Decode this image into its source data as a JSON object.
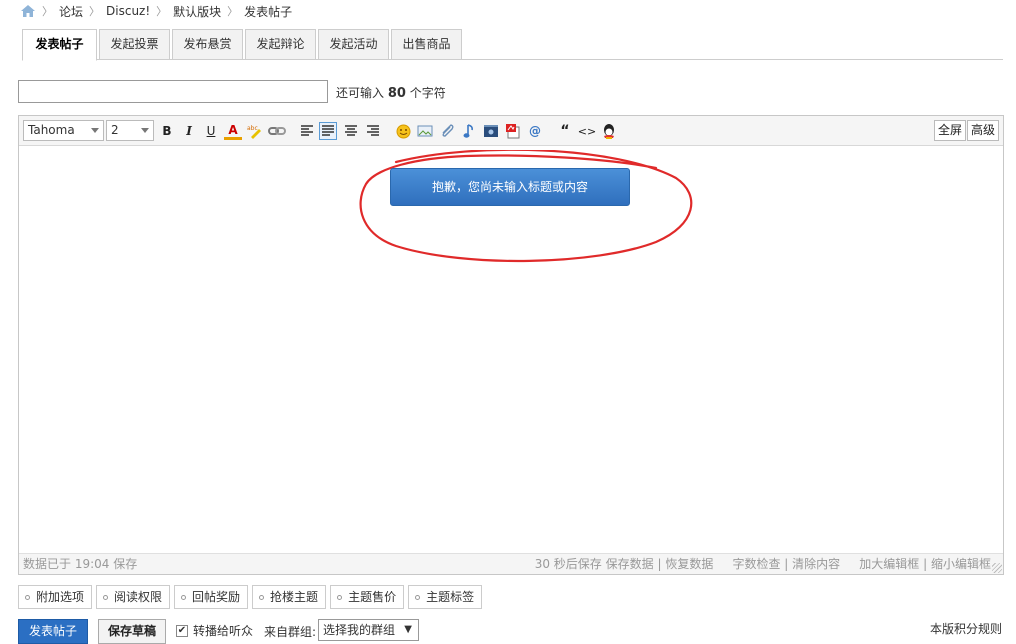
{
  "breadcrumb": {
    "items": [
      "论坛",
      "Discuz!",
      "默认版块",
      "发表帖子"
    ]
  },
  "tabs": [
    {
      "label": "发表帖子",
      "active": true
    },
    {
      "label": "发起投票"
    },
    {
      "label": "发布悬赏"
    },
    {
      "label": "发起辩论"
    },
    {
      "label": "发起活动"
    },
    {
      "label": "出售商品"
    }
  ],
  "subject": {
    "value": "",
    "remain_prefix": "还可输入",
    "remain_count": "80",
    "remain_suffix": "个字符"
  },
  "toolbar": {
    "font": "Tahoma",
    "size": "2",
    "bold": "B",
    "italic": "I",
    "underline": "U",
    "fontcolor": "A",
    "quote": "“",
    "code": "<>",
    "fullscreen": "全屏",
    "advanced": "高级"
  },
  "tip": {
    "message": "抱歉，您尚未输入标题或内容"
  },
  "editor_status": {
    "autosave": "数据已于 19:04 保存",
    "save_timer": "30 秒后保存",
    "save_data": "保存数据",
    "restore_data": "恢复数据",
    "word_check": "字数检查",
    "clear": "清除内容",
    "enlarge": "加大编辑框",
    "shrink": "缩小编辑框"
  },
  "options": [
    "附加选项",
    "阅读权限",
    "回帖奖励",
    "抢楼主题",
    "主题售价",
    "主题标签"
  ],
  "footer": {
    "submit": "发表帖子",
    "draft": "保存草稿",
    "relay": "转播给听众",
    "relay_checked": true,
    "checkmark": "✔",
    "group_label": "来自群组:",
    "group_select": "选择我的群组",
    "rules": "本版积分规则"
  },
  "colors": {
    "primary": "#2b6fc3",
    "tip_blue": "#3a7ccb",
    "annotation_red": "#e02a2a"
  }
}
